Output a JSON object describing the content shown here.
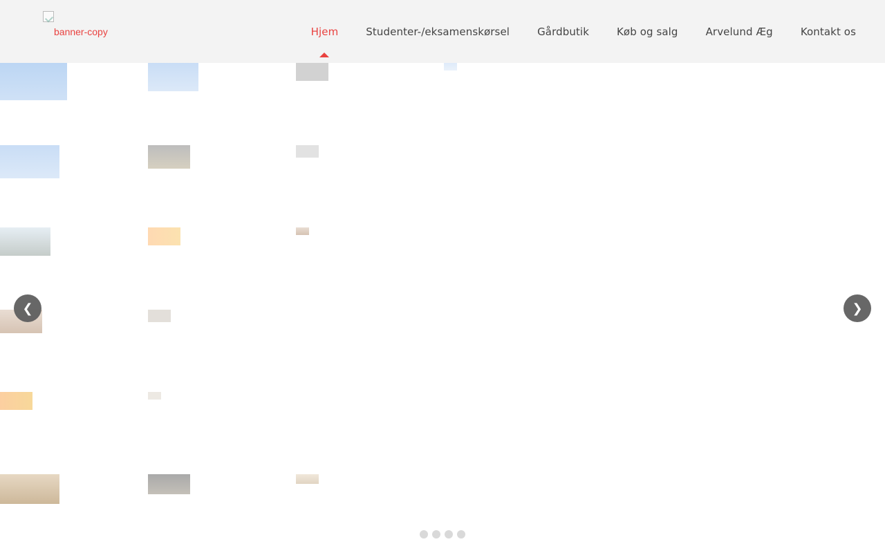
{
  "header": {
    "logo_alt": "banner-copy",
    "nav": [
      {
        "label": "Hjem",
        "active": true
      },
      {
        "label": "Studenter-/eksamenskørsel"
      },
      {
        "label": "Gårdbutik"
      },
      {
        "label": "Køb og salg"
      },
      {
        "label": "Arvelund Æg"
      },
      {
        "label": "Kontakt os"
      }
    ]
  },
  "slider": {
    "prev_icon": "chevron-left-icon",
    "next_icon": "chevron-right-icon",
    "prev_symbol": "❮",
    "next_symbol": "❯",
    "dot_count": 4
  },
  "colors": {
    "accent": "#e94240",
    "nav_bg": "#f3f3f3",
    "nav_text": "#444444",
    "arrow_bg": "#5f5f5f",
    "dot": "#d9d9d9"
  }
}
